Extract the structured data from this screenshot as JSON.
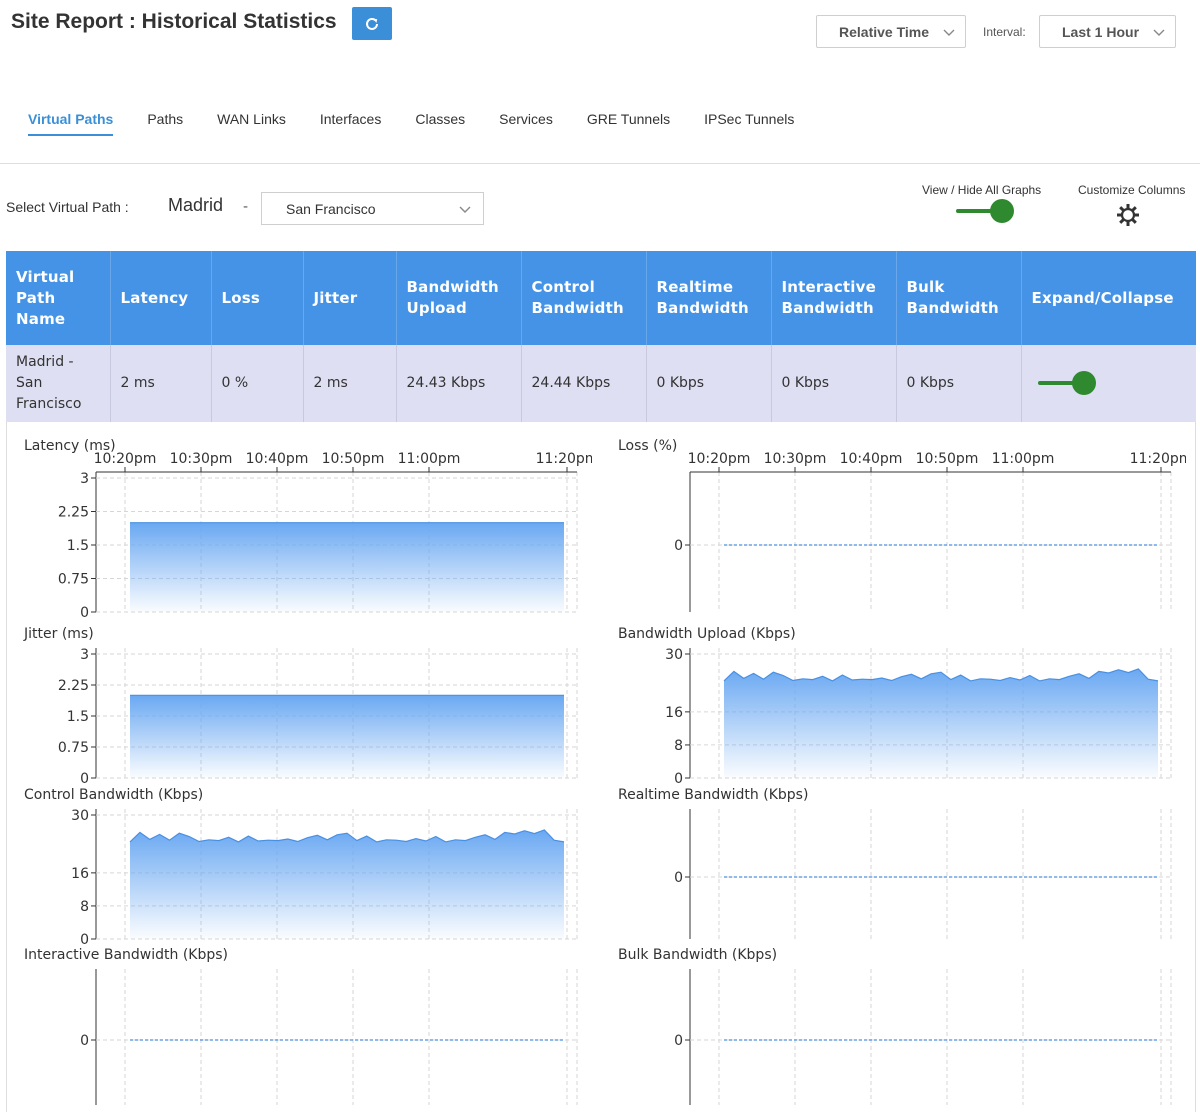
{
  "header": {
    "title": "Site Report : Historical Statistics",
    "time_mode": "Relative Time",
    "interval_label": "Interval:",
    "interval_value": "Last 1 Hour"
  },
  "tabs": [
    {
      "label": "Virtual Paths",
      "active": true
    },
    {
      "label": "Paths",
      "active": false
    },
    {
      "label": "WAN Links",
      "active": false
    },
    {
      "label": "Interfaces",
      "active": false
    },
    {
      "label": "Classes",
      "active": false
    },
    {
      "label": "Services",
      "active": false
    },
    {
      "label": "GRE Tunnels",
      "active": false
    },
    {
      "label": "IPSec Tunnels",
      "active": false
    }
  ],
  "selector": {
    "label": "Select Virtual Path :",
    "origin": "Madrid",
    "separator": "-",
    "destination": "San Francisco",
    "graphs_toggle_label": "View / Hide All Graphs",
    "graphs_toggle_on": true,
    "customize_label": "Customize Columns"
  },
  "table": {
    "headers": [
      "Virtual Path Name",
      "Latency",
      "Loss",
      "Jitter",
      "Bandwidth Upload",
      "Control Bandwidth",
      "Realtime Bandwidth",
      "Interactive Bandwidth",
      "Bulk Bandwidth",
      "Expand/Collapse"
    ],
    "rows": [
      {
        "name": "Madrid - San Francisco",
        "latency": "2 ms",
        "loss": "0 %",
        "jitter": "2 ms",
        "bw_upload": "24.43 Kbps",
        "control_bw": "24.44 Kbps",
        "realtime_bw": "0 Kbps",
        "interactive_bw": "0 Kbps",
        "bulk_bw": "0 Kbps",
        "expanded": true
      }
    ]
  },
  "colors": {
    "accent": "#3b8fd9",
    "table_header": "#4493e6",
    "row_bg": "#dedff2",
    "toggle_on": "#2f8a2f",
    "series_fill": "#6aa8f2",
    "series_line": "#4a90e2"
  },
  "chart_data": [
    {
      "type": "area",
      "title": "Latency (ms)",
      "x_ticks": [
        "10:20pm",
        "10:30pm",
        "10:40pm",
        "10:50pm",
        "11:00pm",
        "11:20pm"
      ],
      "y_ticks": [
        "3",
        "2.25",
        "1.5",
        "0.75",
        "0"
      ],
      "ylim": [
        0,
        3
      ],
      "series": [
        {
          "values": [
            2,
            2,
            2,
            2,
            2,
            2,
            2,
            2,
            2,
            2
          ]
        }
      ]
    },
    {
      "type": "line",
      "title": "Loss (%)",
      "x_ticks": [
        "10:20pm",
        "10:30pm",
        "10:40pm",
        "10:50pm",
        "11:00pm",
        "11:20pm"
      ],
      "y_ticks": [
        "0"
      ],
      "series": [
        {
          "values": [
            0,
            0,
            0,
            0,
            0,
            0,
            0,
            0,
            0,
            0
          ]
        }
      ]
    },
    {
      "type": "area",
      "title": "Jitter (ms)",
      "y_ticks": [
        "3",
        "2.25",
        "1.5",
        "0.75",
        "0"
      ],
      "ylim": [
        0,
        3
      ],
      "series": [
        {
          "values": [
            2,
            2,
            2,
            2,
            2,
            2,
            2,
            2,
            2,
            2
          ]
        }
      ]
    },
    {
      "type": "area",
      "title": "Bandwidth Upload (Kbps)",
      "y_ticks": [
        "30",
        "16",
        "8",
        "0"
      ],
      "ylim": [
        0,
        30
      ],
      "series": [
        {
          "values": [
            23.5,
            25.8,
            24.1,
            25.3,
            23.9,
            25.6,
            24.8,
            23.6,
            24.0,
            23.8,
            24.6,
            23.5,
            24.9,
            23.7,
            23.9,
            23.8,
            24.2,
            23.6,
            24.5,
            25.1,
            24.0,
            25.2,
            25.6,
            23.8,
            24.9,
            23.5,
            24.0,
            23.9,
            23.6,
            24.3,
            23.7,
            24.8,
            23.5,
            24.0,
            23.8,
            24.6,
            25.2,
            24.1,
            25.8,
            25.4,
            26.2,
            25.5,
            26.4,
            23.9,
            23.5
          ]
        }
      ]
    },
    {
      "type": "area",
      "title": "Control Bandwidth (Kbps)",
      "y_ticks": [
        "30",
        "16",
        "8",
        "0"
      ],
      "ylim": [
        0,
        30
      ],
      "series": [
        {
          "values": [
            23.5,
            25.8,
            24.1,
            25.3,
            23.9,
            25.6,
            24.8,
            23.6,
            24.0,
            23.8,
            24.6,
            23.5,
            24.9,
            23.7,
            23.9,
            23.8,
            24.2,
            23.6,
            24.5,
            25.1,
            24.0,
            25.2,
            25.6,
            23.8,
            24.9,
            23.5,
            24.0,
            23.9,
            23.6,
            24.3,
            23.7,
            24.8,
            23.5,
            24.0,
            23.8,
            24.6,
            25.2,
            24.1,
            25.8,
            25.4,
            26.2,
            25.5,
            26.4,
            23.9,
            23.5
          ]
        }
      ]
    },
    {
      "type": "line",
      "title": "Realtime Bandwidth (Kbps)",
      "y_ticks": [
        "0"
      ],
      "series": [
        {
          "values": [
            0,
            0,
            0,
            0,
            0,
            0,
            0,
            0,
            0,
            0
          ]
        }
      ]
    },
    {
      "type": "line",
      "title": "Interactive Bandwidth (Kbps)",
      "y_ticks": [
        "0"
      ],
      "series": [
        {
          "values": [
            0,
            0,
            0,
            0,
            0,
            0,
            0,
            0,
            0,
            0
          ]
        }
      ]
    },
    {
      "type": "line",
      "title": "Bulk Bandwidth (Kbps)",
      "y_ticks": [
        "0"
      ],
      "series": [
        {
          "values": [
            0,
            0,
            0,
            0,
            0,
            0,
            0,
            0,
            0,
            0
          ]
        }
      ]
    }
  ]
}
